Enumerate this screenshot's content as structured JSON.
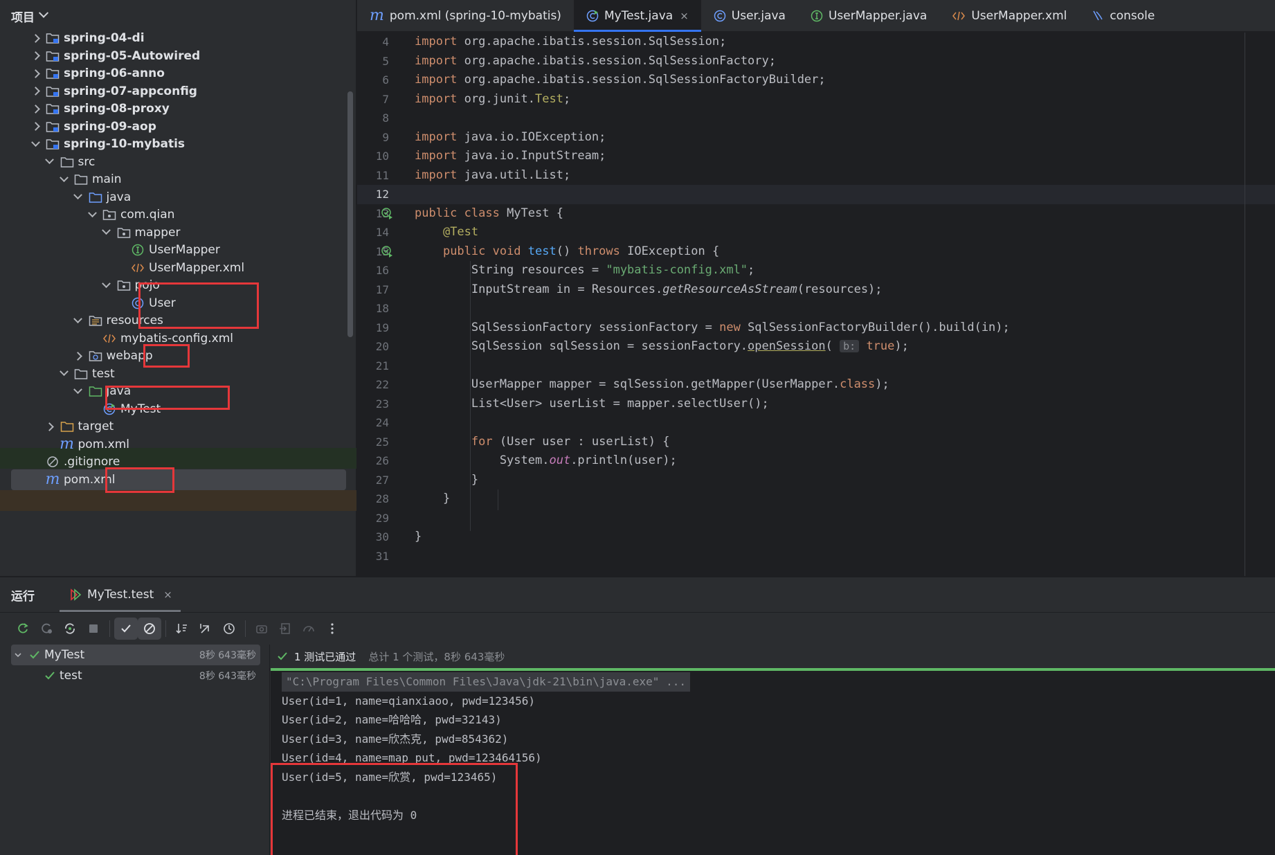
{
  "project": {
    "title": "项目",
    "tree": [
      {
        "label": "spring-04-di",
        "depth": 0,
        "arrow": "right",
        "icon": "module-folder-icon",
        "bold": true
      },
      {
        "label": "spring-05-Autowired",
        "depth": 0,
        "arrow": "right",
        "icon": "module-folder-icon",
        "bold": true
      },
      {
        "label": "spring-06-anno",
        "depth": 0,
        "arrow": "right",
        "icon": "module-folder-icon",
        "bold": true
      },
      {
        "label": "spring-07-appconfig",
        "depth": 0,
        "arrow": "right",
        "icon": "module-folder-icon",
        "bold": true
      },
      {
        "label": "spring-08-proxy",
        "depth": 0,
        "arrow": "right",
        "icon": "module-folder-icon",
        "bold": true
      },
      {
        "label": "spring-09-aop",
        "depth": 0,
        "arrow": "right",
        "icon": "module-folder-icon",
        "bold": true
      },
      {
        "label": "spring-10-mybatis",
        "depth": 0,
        "arrow": "down",
        "icon": "module-folder-icon",
        "bold": true
      },
      {
        "label": "src",
        "depth": 1,
        "arrow": "down",
        "icon": "folder-icon"
      },
      {
        "label": "main",
        "depth": 2,
        "arrow": "down",
        "icon": "folder-icon"
      },
      {
        "label": "java",
        "depth": 3,
        "arrow": "down",
        "icon": "source-folder-icon"
      },
      {
        "label": "com.qian",
        "depth": 4,
        "arrow": "down",
        "icon": "package-icon"
      },
      {
        "label": "mapper",
        "depth": 5,
        "arrow": "down",
        "icon": "package-icon"
      },
      {
        "label": "UserMapper",
        "depth": 6,
        "arrow": "none",
        "icon": "interface-icon"
      },
      {
        "label": "UserMapper.xml",
        "depth": 6,
        "arrow": "none",
        "icon": "xml-icon"
      },
      {
        "label": "pojo",
        "depth": 5,
        "arrow": "down",
        "icon": "package-icon"
      },
      {
        "label": "User",
        "depth": 6,
        "arrow": "none",
        "icon": "class-icon"
      },
      {
        "label": "resources",
        "depth": 3,
        "arrow": "down",
        "icon": "resources-folder-icon"
      },
      {
        "label": "mybatis-config.xml",
        "depth": 4,
        "arrow": "none",
        "icon": "xml-icon"
      },
      {
        "label": "webapp",
        "depth": 3,
        "arrow": "right",
        "icon": "web-folder-icon"
      },
      {
        "label": "test",
        "depth": 2,
        "arrow": "down",
        "icon": "folder-icon"
      },
      {
        "label": "java",
        "depth": 3,
        "arrow": "down",
        "icon": "test-folder-icon"
      },
      {
        "label": "MyTest",
        "depth": 4,
        "arrow": "none",
        "icon": "test-class-icon"
      },
      {
        "label": "target",
        "depth": 1,
        "arrow": "right",
        "icon": "excluded-folder-icon"
      },
      {
        "label": "pom.xml",
        "depth": 1,
        "arrow": "none",
        "icon": "maven-icon"
      },
      {
        "label": ".gitignore",
        "depth": 0,
        "arrow": "none",
        "icon": "ignore-icon"
      },
      {
        "label": "pom.xml",
        "depth": 0,
        "arrow": "none",
        "icon": "maven-icon"
      }
    ]
  },
  "tabs": [
    {
      "label": "pom.xml (spring-10-mybatis)",
      "icon": "maven-icon",
      "active": false
    },
    {
      "label": "MyTest.java",
      "icon": "test-class-icon",
      "active": true,
      "close": "×"
    },
    {
      "label": "User.java",
      "icon": "class-icon",
      "active": false
    },
    {
      "label": "UserMapper.java",
      "icon": "interface-icon",
      "active": false
    },
    {
      "label": "UserMapper.xml",
      "icon": "xml-icon",
      "active": false
    },
    {
      "label": "console",
      "icon": "console-icon",
      "active": false
    }
  ],
  "editor": {
    "current_line": 12,
    "lines": [
      {
        "n": 4,
        "html": "<span class='kw'>import</span> org.apache.ibatis.session.SqlSession;"
      },
      {
        "n": 5,
        "html": "<span class='kw'>import</span> org.apache.ibatis.session.SqlSessionFactory;"
      },
      {
        "n": 6,
        "html": "<span class='kw'>import</span> org.apache.ibatis.session.SqlSessionFactoryBuilder;"
      },
      {
        "n": 7,
        "html": "<span class='kw'>import</span> org.junit.<span class='ann'>Test</span>;"
      },
      {
        "n": 8,
        "html": ""
      },
      {
        "n": 9,
        "html": "<span class='kw'>import</span> java.io.IOException;"
      },
      {
        "n": 10,
        "html": "<span class='kw'>import</span> java.io.InputStream;"
      },
      {
        "n": 11,
        "html": "<span class='kw'>import</span> java.util.List;"
      },
      {
        "n": 12,
        "html": ""
      },
      {
        "n": 13,
        "html": "<span class='kw'>public class</span> MyTest {",
        "run": true
      },
      {
        "n": 14,
        "html": "    <span class='ann'>@Test</span>"
      },
      {
        "n": 15,
        "html": "    <span class='kw'>public void</span> <span class='fn'>test</span>() <span class='kw'>throws</span> IOException {",
        "run": true
      },
      {
        "n": 16,
        "html": "        String resources = <span class='str'>\"mybatis-config.xml\"</span>;"
      },
      {
        "n": 17,
        "html": "        InputStream in = Resources.<span class='it'>getResourceAsStream</span>(resources);"
      },
      {
        "n": 18,
        "html": ""
      },
      {
        "n": 19,
        "html": "        SqlSessionFactory sessionFactory = <span class='kw'>new</span> SqlSessionFactoryBuilder().build(in);"
      },
      {
        "n": 20,
        "html": "        SqlSession sqlSession = sessionFactory.<span class='und'>openSession</span>( <span class='hint'>b:</span> <span class='kw'>true</span>);"
      },
      {
        "n": 21,
        "html": ""
      },
      {
        "n": 22,
        "html": "        UserMapper mapper = sqlSession.getMapper(UserMapper.<span class='kw'>class</span>);"
      },
      {
        "n": 23,
        "html": "        List&lt;User&gt; userList = mapper.selectUser();"
      },
      {
        "n": 24,
        "html": ""
      },
      {
        "n": 25,
        "html": "        <span class='kw'>for</span> (User user : userList) {"
      },
      {
        "n": 26,
        "html": "            System.<span class='field'>out</span>.println(user);"
      },
      {
        "n": 27,
        "html": "        }"
      },
      {
        "n": 28,
        "html": "    }"
      },
      {
        "n": 29,
        "html": ""
      },
      {
        "n": 30,
        "html": "}"
      },
      {
        "n": 31,
        "html": ""
      }
    ]
  },
  "run": {
    "title": "运行",
    "tab_label": "MyTest.test",
    "tab_close": "×",
    "tree": [
      {
        "label": "MyTest",
        "time": "8秒 643毫秒",
        "selected": true
      },
      {
        "label": "test",
        "time": "8秒 643毫秒",
        "selected": false
      }
    ],
    "status": "1 测试已通过",
    "summary": "总计 1 个测试，8秒 643毫秒",
    "console": [
      "\"C:\\Program Files\\Common Files\\Java\\jdk-21\\bin\\java.exe\" ...",
      "User(id=1, name=qianxiaoo, pwd=123456)",
      "User(id=2, name=哈哈哈, pwd=32143)",
      "User(id=3, name=欣杰克, pwd=854362)",
      "User(id=4, name=map_put, pwd=123464156)",
      "User(id=5, name=欣赏, pwd=123465)",
      "",
      "进程已结束，退出代码为 0"
    ]
  },
  "colors": {
    "accent": "#3574f0",
    "pass": "#5fb865",
    "highlight_box": "#e5373a"
  }
}
